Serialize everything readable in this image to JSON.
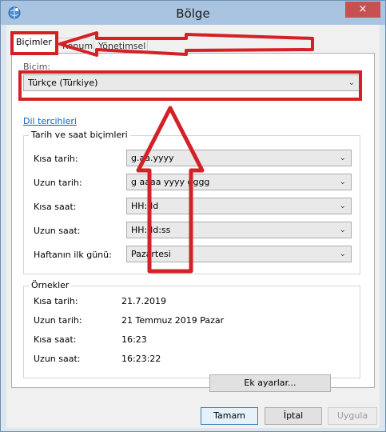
{
  "window": {
    "title": "Bölge",
    "close_glyph": "×"
  },
  "tabs": [
    {
      "label": "Biçimler"
    },
    {
      "label": "Konum"
    },
    {
      "label": "Yönetimsel"
    }
  ],
  "format_section": {
    "label": "Biçim:",
    "selected": "Türkçe (Türkiye)"
  },
  "language_prefs_link": "Dil tercihleri",
  "datetime_group": {
    "title": "Tarih ve saat biçimleri",
    "rows": [
      {
        "label": "Kısa tarih:",
        "value": "g.aa.yyyy"
      },
      {
        "label": "Uzun tarih:",
        "value": "g aaaa yyyy gggg"
      },
      {
        "label": "Kısa saat:",
        "value": "HH:dd"
      },
      {
        "label": "Uzun saat:",
        "value": "HH:dd:ss"
      },
      {
        "label": "Haftanın ilk günü:",
        "value": "Pazartesi"
      }
    ]
  },
  "examples_group": {
    "title": "Örnekler",
    "rows": [
      {
        "label": "Kısa tarih:",
        "value": "21.7.2019"
      },
      {
        "label": "Uzun tarih:",
        "value": "21 Temmuz 2019 Pazar"
      },
      {
        "label": "Kısa saat:",
        "value": "16:23"
      },
      {
        "label": "Uzun saat:",
        "value": "16:23:22"
      }
    ]
  },
  "buttons": {
    "additional": "Ek ayarlar...",
    "ok": "Tamam",
    "cancel": "İptal",
    "apply": "Uygula"
  },
  "colors": {
    "annotation_red": "#d42027",
    "link_blue": "#0066cc",
    "titlebar": "#a9c4e0"
  }
}
